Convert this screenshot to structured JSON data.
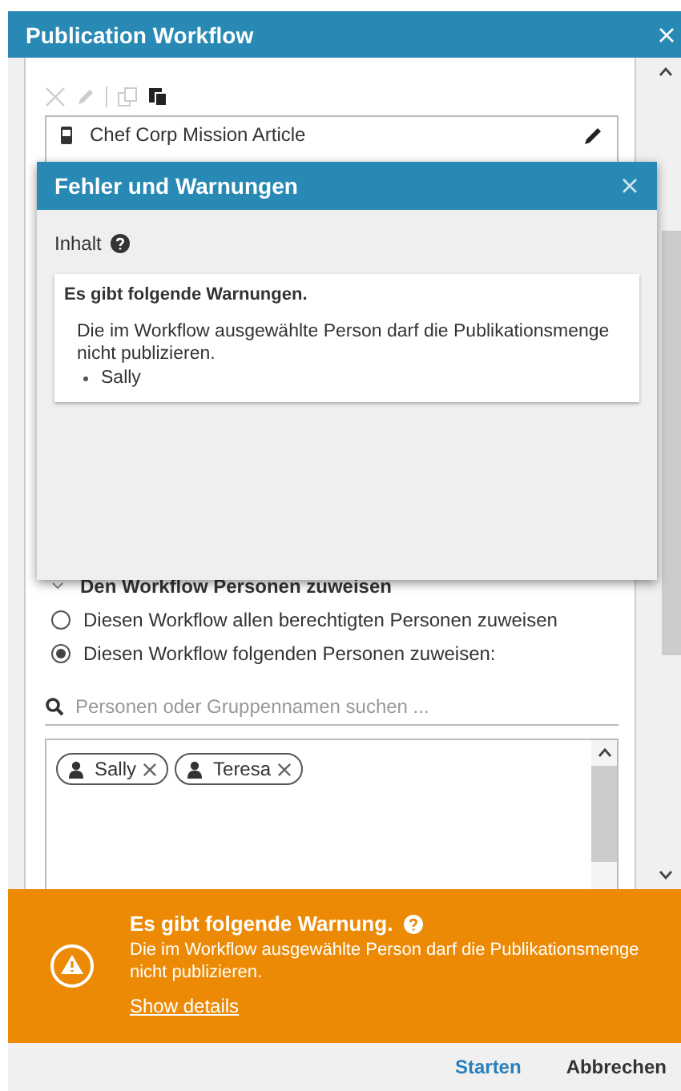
{
  "window": {
    "title": "Publication Workflow"
  },
  "content": {
    "tools": [
      {
        "kind": "delete",
        "disabled": true
      },
      {
        "kind": "edit",
        "disabled": true
      },
      {
        "kind": "copy",
        "disabled": true
      },
      {
        "kind": "paste",
        "disabled": false
      }
    ],
    "items": [
      {
        "title": "Chef Corp Mission Article"
      }
    ]
  },
  "assign": {
    "title": "Den Workflow Personen zuweisen",
    "expanded": true,
    "options": [
      {
        "label": "Diesen Workflow allen berechtigten Personen zuweisen",
        "selected": false
      },
      {
        "label": "Diesen Workflow folgenden Personen zuweisen:",
        "selected": true
      }
    ],
    "search": {
      "placeholder": "Personen oder Gruppennamen suchen ..."
    },
    "people": [
      {
        "name": "Sally"
      },
      {
        "name": "Teresa"
      }
    ]
  },
  "banner": {
    "title": "Es gibt folgende Warnung.",
    "message": "Die im Workflow ausgewählte Person darf die Publikationsmenge nicht publizieren.",
    "link": "Show details"
  },
  "buttons": [
    {
      "label": "Starten",
      "kind": "primary"
    },
    {
      "label": "Abbrechen",
      "kind": "secondary"
    }
  ],
  "dialog": {
    "title": "Fehler und Warnungen",
    "section": "Inhalt",
    "card": {
      "title": "Es gibt folgende Warnungen.",
      "message": "Die im Workflow ausgewählte Person darf die Publikationsmenge nicht publizieren.",
      "items": [
        "Sally"
      ]
    }
  }
}
